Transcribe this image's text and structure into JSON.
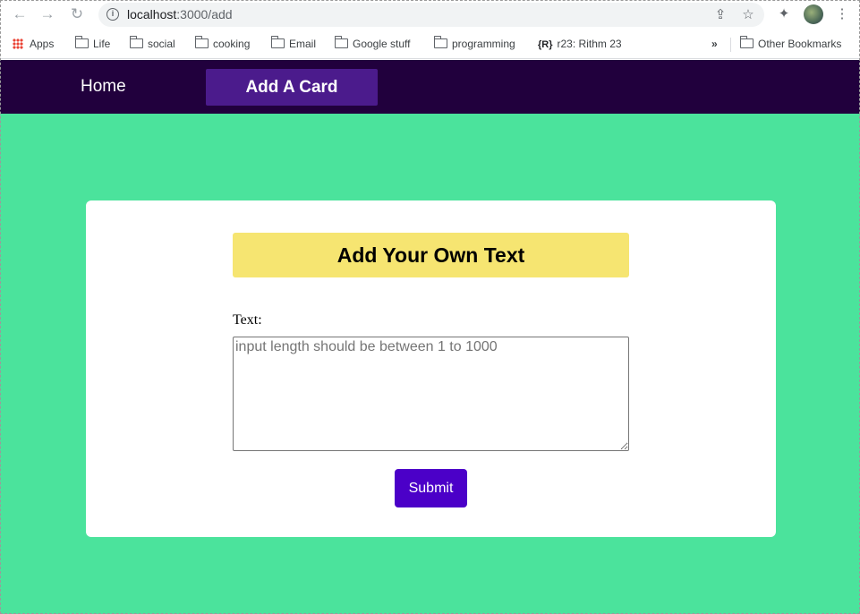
{
  "browser": {
    "url_host": "localhost",
    "url_path": ":3000/add",
    "bookmarks": [
      {
        "label": "Apps",
        "icon": "apps-grid-icon"
      },
      {
        "label": "Life",
        "icon": "folder-icon"
      },
      {
        "label": "social",
        "icon": "folder-icon"
      },
      {
        "label": "cooking",
        "icon": "folder-icon"
      },
      {
        "label": "Email",
        "icon": "folder-icon"
      },
      {
        "label": "Google stuff",
        "icon": "folder-icon"
      },
      {
        "label": "programming",
        "icon": "folder-icon"
      },
      {
        "label": "r23: Rithm 23",
        "icon": "r-bracket-icon"
      }
    ],
    "overflow_label": "»",
    "other_bookmarks_label": "Other Bookmarks"
  },
  "nav": {
    "home_label": "Home",
    "add_label": "Add A Card"
  },
  "form": {
    "title": "Add Your Own Text",
    "field_label": "Text:",
    "placeholder": "input length should be between 1 to 1000",
    "value": "",
    "submit_label": "Submit"
  },
  "colors": {
    "nav_bg": "#21003d",
    "nav_active_bg": "#4b1b8c",
    "page_bg": "#4be39c",
    "title_bg": "#f6e571",
    "submit_bg": "#4b00c8"
  }
}
